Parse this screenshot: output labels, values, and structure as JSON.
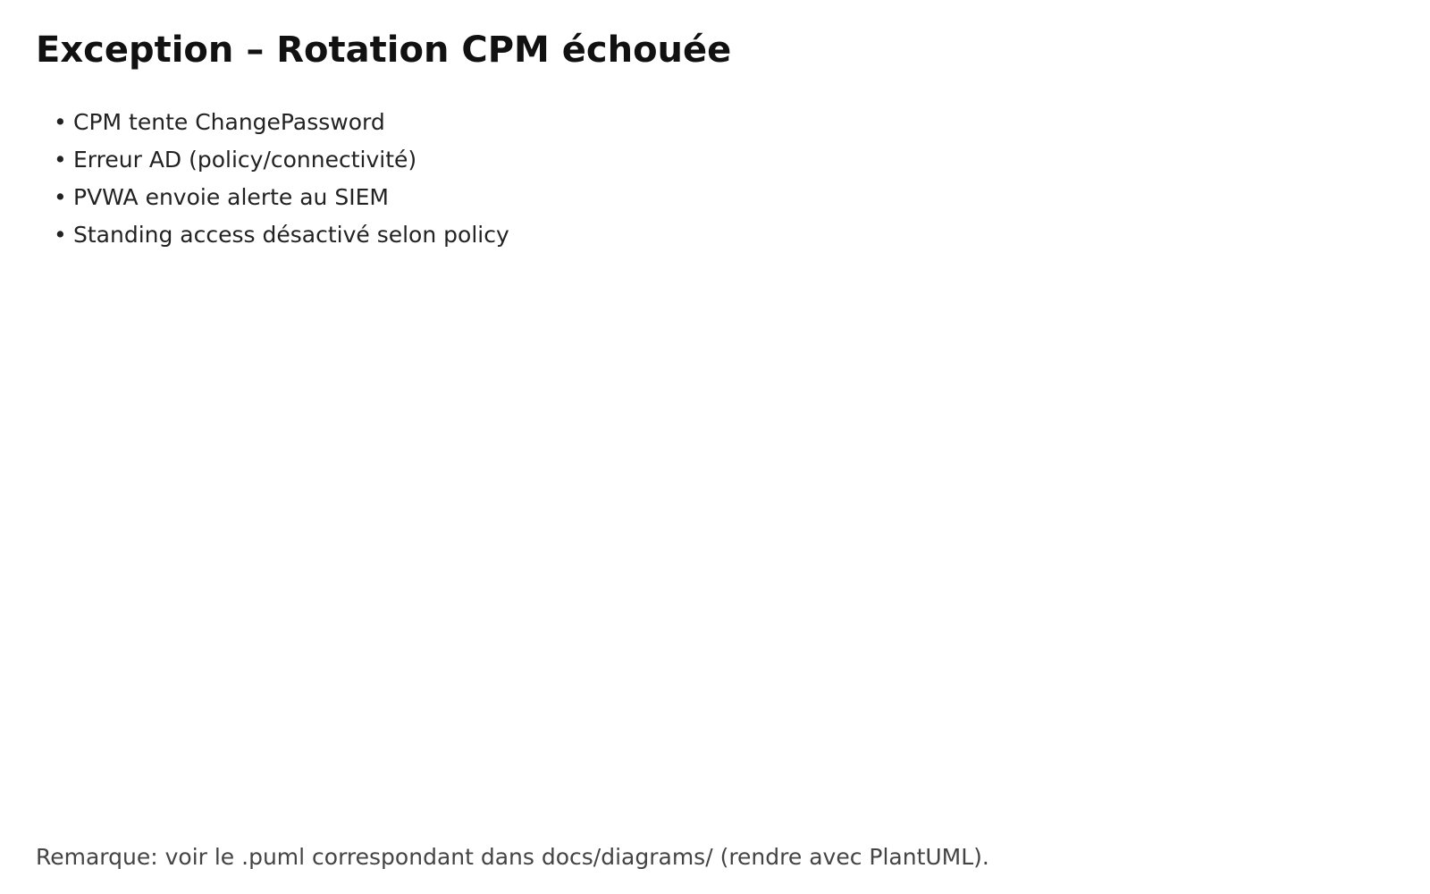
{
  "title": "Exception – Rotation CPM échouée",
  "bullet_symbol": "•",
  "bullets": [
    "CPM tente ChangePassword",
    "Erreur AD (policy/connectivité)",
    "PVWA envoie alerte au SIEM",
    "Standing access désactivé selon policy"
  ],
  "footer_note": "Remarque: voir le .puml correspondant dans docs/diagrams/ (rendre avec PlantUML)."
}
